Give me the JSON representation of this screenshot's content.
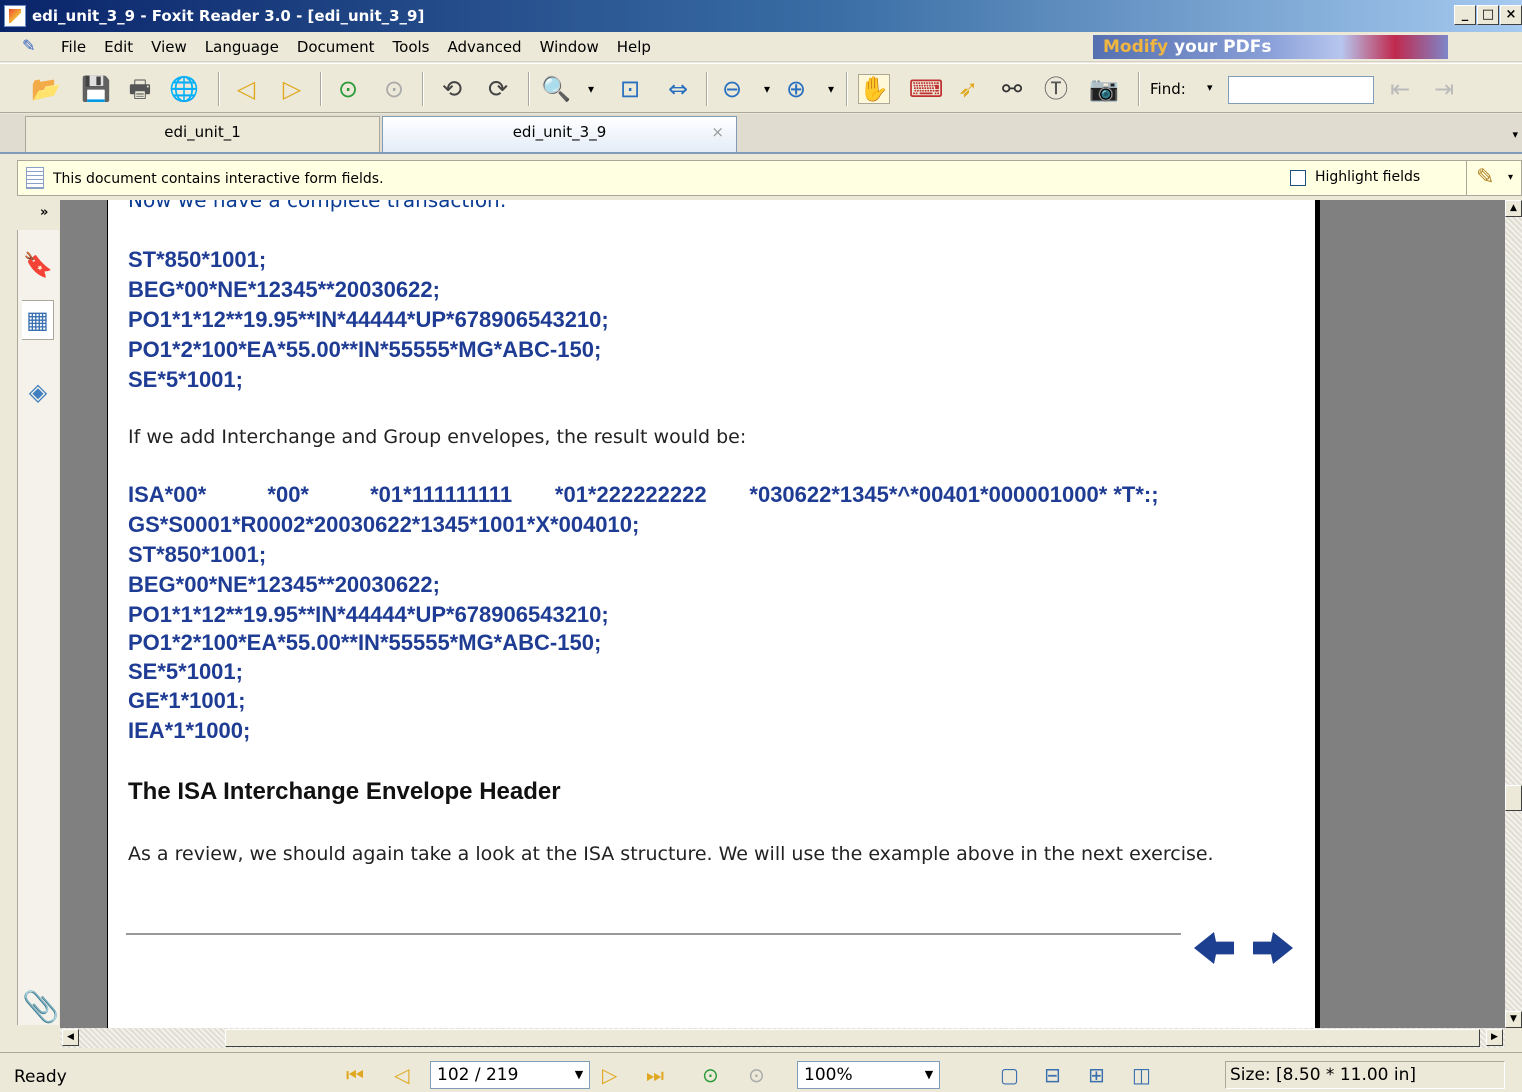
{
  "window": {
    "title": "edi_unit_3_9 - Foxit Reader 3.0 - [edi_unit_3_9]",
    "controls": [
      "_",
      "□",
      "×"
    ]
  },
  "menu": {
    "items": [
      "File",
      "Edit",
      "View",
      "Language",
      "Document",
      "Tools",
      "Advanced",
      "Window",
      "Help"
    ],
    "ad_part1": "Modify",
    "ad_part2": " your PDFs"
  },
  "toolbar": {
    "find_label": "Find:",
    "find_value": ""
  },
  "tabs": [
    {
      "label": "edi_unit_1",
      "active": false
    },
    {
      "label": "edi_unit_3_9",
      "active": true,
      "close": "×"
    }
  ],
  "form_notice": {
    "message": "This document contains interactive form fields.",
    "highlight_label": "Highlight fields",
    "highlight_checked": false
  },
  "document": {
    "cut_line": "Now we have a complete transaction:",
    "transaction_lines": [
      "ST*850*1001;",
      "BEG*00*NE*12345**20030622;",
      "PO1*1*12**19.95**IN*44444*UP*678906543210;",
      "PO1*2*100*EA*55.00**IN*55555*MG*ABC-150;",
      "SE*5*1001;"
    ],
    "envelope_intro": "If we add Interchange and Group envelopes, the result would be:",
    "envelope_lines": [
      "ISA*00*          *00*          *01*111111111       *01*222222222       *030622*1345*^*00401*000001000* *T*:;",
      "GS*S0001*R0002*20030622*1345*1001*X*004010;",
      "ST*850*1001;",
      "BEG*00*NE*12345**20030622;",
      "PO1*1*12**19.95**IN*44444*UP*678906543210;",
      "PO1*2*100*EA*55.00**IN*55555*MG*ABC-150;",
      "SE*5*1001;",
      "GE*1*1001;",
      "IEA*1*1000;"
    ],
    "heading": "The ISA Interchange Envelope Header",
    "review_text": "As a review, we should again take a look at the ISA structure. We will use the example above in the next exercise."
  },
  "status": {
    "ready": "Ready",
    "page": "102 / 219",
    "zoom": "100%",
    "size": "Size: [8.50 * 11.00 in]"
  },
  "colors": {
    "edi_code": "#1f3c94",
    "title_bar": "#0a246a",
    "form_bar": "#ffffe1"
  }
}
